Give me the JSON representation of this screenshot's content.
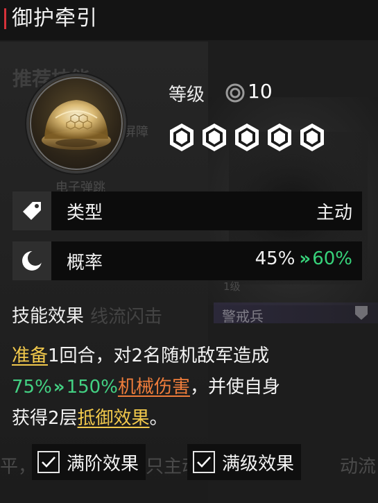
{
  "header": {
    "title": "御护牵引"
  },
  "background": {
    "ghost_title": "推荐技能",
    "ghost_item_1": "电屏障",
    "ghost_item_2": "电子弹跳",
    "ghost_item_3": "线流闪击",
    "ghost_level": "1级",
    "ghost_unit": "警戒兵",
    "ghost_bottom_left": "平，",
    "ghost_bottom_mid": "只主动",
    "ghost_bottom_right": "动流"
  },
  "skill": {
    "icon": "energy-dome-icon",
    "level_label": "等级",
    "level_value": "10",
    "star_count": 5,
    "star_filled": 5
  },
  "rows": {
    "type_icon": "tag-icon",
    "type_label": "类型",
    "type_value": "主动",
    "rate_icon": "moon-icon",
    "rate_label": "概率",
    "rate_old": "45%",
    "rate_arrow": "»",
    "rate_new": "60%"
  },
  "effects": {
    "heading": "技能效果",
    "kw_prepare": "准备",
    "t1": "1回合，对2名随机敌军造成",
    "dmg_old": "75%",
    "dmg_arrow": "»",
    "dmg_new": "150%",
    "kw_mech_damage": "机械伤害",
    "t2": "，并使自身",
    "t3": "获得2层",
    "kw_guard_effect": "抵御效果",
    "t4": "。"
  },
  "toggles": {
    "max_tier_label": "满阶效果",
    "max_tier_checked": true,
    "max_level_label": "满级效果",
    "max_level_checked": true
  },
  "colors": {
    "accent_red": "#d6323a",
    "upgrade_green": "#43d183",
    "keyword_yellow": "#f2c94c",
    "keyword_orange": "#ef7d3b"
  }
}
